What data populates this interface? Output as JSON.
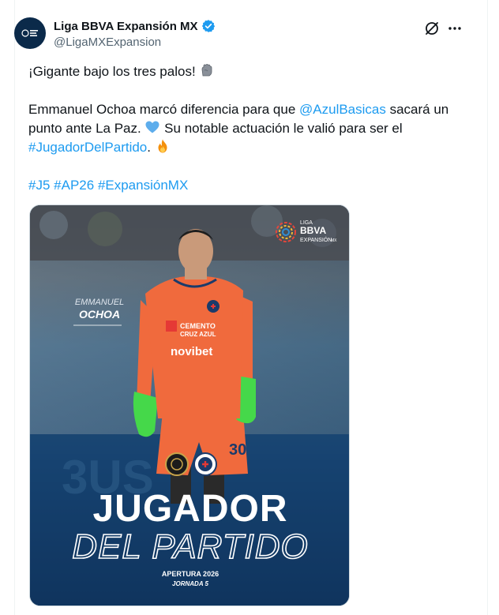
{
  "account": {
    "display_name": "Liga BBVA Expansión MX",
    "handle": "@LigaMXExpansion",
    "verified_color": "#1d9bf0"
  },
  "tweet": {
    "line1": "¡Gigante bajo los tres palos!",
    "line1_emoji": "gloves-emoji",
    "p2_a": "Emmanuel Ochoa marcó diferencia para que ",
    "p2_mention": "@AzulBasicas",
    "p2_b": " sacará un",
    "p2_c": "punto ante La Paz. ",
    "p2_d": " Su notable actuación le valió para ser el",
    "p2_hashtag": "#JugadorDelPartido",
    "p2_e": ". ",
    "hashtags": [
      "#J5",
      "#AP26",
      "#ExpansiónMX"
    ]
  },
  "media": {
    "logo_lines": [
      "LIGA",
      "BBVA",
      "EXPANSIÓN",
      "MX"
    ],
    "player_first": "EMMANUEL",
    "player_last": "OCHOA",
    "shirt_sponsor1": "CEMENTO",
    "shirt_sponsor2": "CRUZ AZUL",
    "shirt_sponsor3": "novibet",
    "shirt_number": "30",
    "title1": "JUGADOR",
    "title2": "DEL PARTIDO",
    "season": "APERTURA 2026",
    "round": "JORNADA 5"
  },
  "colors": {
    "link": "#1d9bf0",
    "text": "#0f1419",
    "muted": "#536471",
    "jersey": "#f06a3d",
    "gloves": "#45d84a"
  }
}
